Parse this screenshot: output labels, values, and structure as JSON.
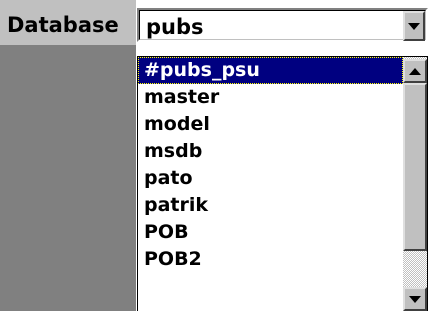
{
  "label": "Database",
  "combo": {
    "value": "pubs"
  },
  "dropdown": {
    "items": [
      "#pubs_psu",
      "master",
      "model",
      "msdb",
      "pato",
      "patrik",
      "POB",
      "POB2"
    ],
    "selected_index": 0
  },
  "icons": {
    "combo_button": "chevron-down-icon",
    "scroll_up": "arrow-up-icon",
    "scroll_down": "arrow-down-icon"
  },
  "colors": {
    "selection_bg": "#000080",
    "face": "#c0c0c0",
    "panel_dark": "#808080"
  }
}
